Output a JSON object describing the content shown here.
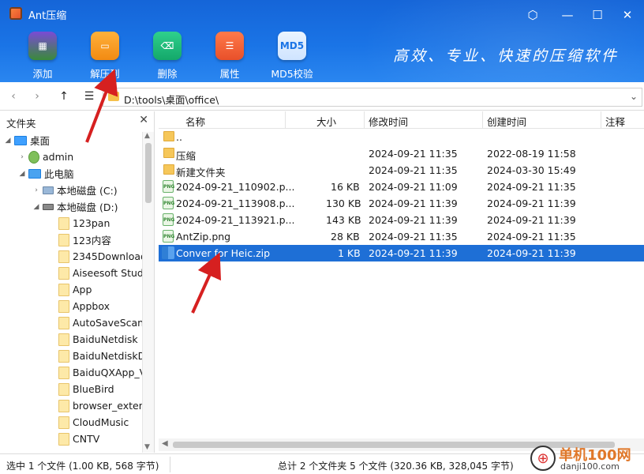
{
  "window": {
    "title": "Ant压缩"
  },
  "toolbar": {
    "add": "添加",
    "extract": "解压到",
    "delete": "删除",
    "properties": "属性",
    "md5": "MD5校验",
    "md5_icon_text": "MD5",
    "slogan": "高效、专业、快速的压缩软件"
  },
  "address": {
    "path": "D:\\tools\\桌面\\office\\"
  },
  "left_panel": {
    "title": "文件夹",
    "tree": [
      {
        "label": "桌面"
      },
      {
        "label": "admin"
      },
      {
        "label": "此电脑"
      },
      {
        "label": "本地磁盘 (C:)"
      },
      {
        "label": "本地磁盘 (D:)"
      },
      {
        "label": "123pan"
      },
      {
        "label": "123内容"
      },
      {
        "label": "2345Download"
      },
      {
        "label": "Aiseesoft Studi"
      },
      {
        "label": "App"
      },
      {
        "label": "Appbox"
      },
      {
        "label": "AutoSaveScan"
      },
      {
        "label": "BaiduNetdisk"
      },
      {
        "label": "BaiduNetdiskD"
      },
      {
        "label": "BaiduQXApp_V"
      },
      {
        "label": "BlueBird"
      },
      {
        "label": "browser_extens"
      },
      {
        "label": "CloudMusic"
      },
      {
        "label": "CNTV"
      }
    ]
  },
  "file_list": {
    "columns": [
      "名称",
      "大小",
      "修改时间",
      "创建时间",
      "注释"
    ],
    "rows": [
      {
        "name": "..",
        "size": "",
        "modified": "",
        "created": "",
        "icon": "folder-icon"
      },
      {
        "name": "压缩",
        "size": "",
        "modified": "2024-09-21 11:35",
        "created": "2022-08-19 11:58",
        "icon": "folder-icon"
      },
      {
        "name": "新建文件夹",
        "size": "",
        "modified": "2024-09-21 11:35",
        "created": "2024-03-30 15:49",
        "icon": "folder-icon"
      },
      {
        "name": "2024-09-21_110902.p...",
        "size": "16 KB",
        "modified": "2024-09-21 11:09",
        "created": "2024-09-21 11:35",
        "icon": "png-file-icon"
      },
      {
        "name": "2024-09-21_113908.p...",
        "size": "130 KB",
        "modified": "2024-09-21 11:39",
        "created": "2024-09-21 11:39",
        "icon": "png-file-icon"
      },
      {
        "name": "2024-09-21_113921.p...",
        "size": "143 KB",
        "modified": "2024-09-21 11:39",
        "created": "2024-09-21 11:39",
        "icon": "png-file-icon"
      },
      {
        "name": "AntZip.png",
        "size": "28 KB",
        "modified": "2024-09-21 11:35",
        "created": "2024-09-21 11:35",
        "icon": "png-file-icon"
      },
      {
        "name": "Conver for Heic.zip",
        "size": "1 KB",
        "modified": "2024-09-21 11:39",
        "created": "2024-09-21 11:39",
        "icon": "zip-file-icon",
        "selected": true
      }
    ],
    "png_icon_text": "PNG"
  },
  "status": {
    "selection": "选中 1 个文件 (1.00 KB, 568 字节)",
    "total": "总计 2 个文件夹 5 个文件 (320.36 KB, 328,045 字节)"
  },
  "watermark": {
    "line1": "单机100网",
    "line2": "danji100.com"
  },
  "colors": {
    "header": "#1a74e6",
    "selection": "#1e6fd6",
    "arrow": "#d62020"
  }
}
